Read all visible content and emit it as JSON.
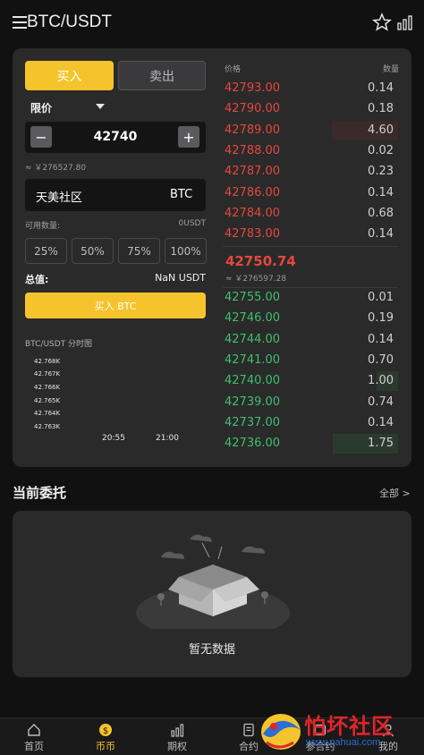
{
  "header": {
    "title": "BTC/USDT",
    "menu_icon": "menu-icon",
    "star_icon": "star-icon",
    "chart_icon": "bar-chart-icon"
  },
  "trade_form": {
    "buy_tab": "买入",
    "sell_tab": "卖出",
    "order_type": "限价",
    "price": "42740",
    "price_approx": "≈ ￥276527.80",
    "minus": "−",
    "plus": "+",
    "community_name": "天美社区",
    "community_unit": "BTC",
    "available_label": "可用数量:",
    "available_value": "0USDT",
    "percents": [
      "25%",
      "50%",
      "75%",
      "100%"
    ],
    "total_label": "总值:",
    "total_value": "NaN USDT",
    "buy_button": "买入 BTC"
  },
  "mini_chart": {
    "title": "BTC/USDT 分时图",
    "ticks": [
      "42.768K",
      "42.767K",
      "42.766K",
      "42.765K",
      "42.764K",
      "42.763K"
    ],
    "times": [
      "20:55",
      "21:00"
    ]
  },
  "order_book": {
    "price_header": "价格",
    "qty_header": "数量",
    "asks": [
      {
        "price": "42793.00",
        "qty": "0.14",
        "depth": 0
      },
      {
        "price": "42790.00",
        "qty": "0.18",
        "depth": 0
      },
      {
        "price": "42789.00",
        "qty": "4.60",
        "depth": 0.38
      },
      {
        "price": "42788.00",
        "qty": "0.02",
        "depth": 0
      },
      {
        "price": "42787.00",
        "qty": "0.23",
        "depth": 0
      },
      {
        "price": "42786.00",
        "qty": "0.14",
        "depth": 0
      },
      {
        "price": "42784.00",
        "qty": "0.68",
        "depth": 0
      },
      {
        "price": "42783.00",
        "qty": "0.14",
        "depth": 0
      }
    ],
    "last_price": "42750.74",
    "last_approx": "≈ ￥276597.28",
    "bids": [
      {
        "price": "42755.00",
        "qty": "0.01",
        "depth": 0
      },
      {
        "price": "42746.00",
        "qty": "0.19",
        "depth": 0
      },
      {
        "price": "42744.00",
        "qty": "0.14",
        "depth": 0
      },
      {
        "price": "42741.00",
        "qty": "0.70",
        "depth": 0
      },
      {
        "price": "42740.00",
        "qty": "1.00",
        "depth": 0.12
      },
      {
        "price": "42739.00",
        "qty": "0.74",
        "depth": 0
      },
      {
        "price": "42737.00",
        "qty": "0.14",
        "depth": 0
      },
      {
        "price": "42736.00",
        "qty": "1.75",
        "depth": 0.37
      }
    ]
  },
  "orders": {
    "title": "当前委托",
    "all_link": "全部 >",
    "empty_text": "暂无数据",
    "empty_icon": "empty-box-illustration"
  },
  "tabbar": {
    "items": [
      {
        "label": "首页",
        "icon": "home-icon"
      },
      {
        "label": "币币",
        "icon": "coin-icon"
      },
      {
        "label": "期权",
        "icon": "signal-bars-icon"
      },
      {
        "label": "合约",
        "icon": "document-icon"
      },
      {
        "label": "参合约",
        "icon": "contract-icon"
      },
      {
        "label": "我的",
        "icon": "profile-icon"
      }
    ]
  },
  "watermark": {
    "title": "怕坏社区",
    "url": "www.pahuai.com"
  },
  "colors": {
    "accent": "#f5c42c",
    "ask": "#e5473f",
    "bid": "#3fbf6f",
    "card": "#2a2a2a",
    "background": "#111111"
  }
}
